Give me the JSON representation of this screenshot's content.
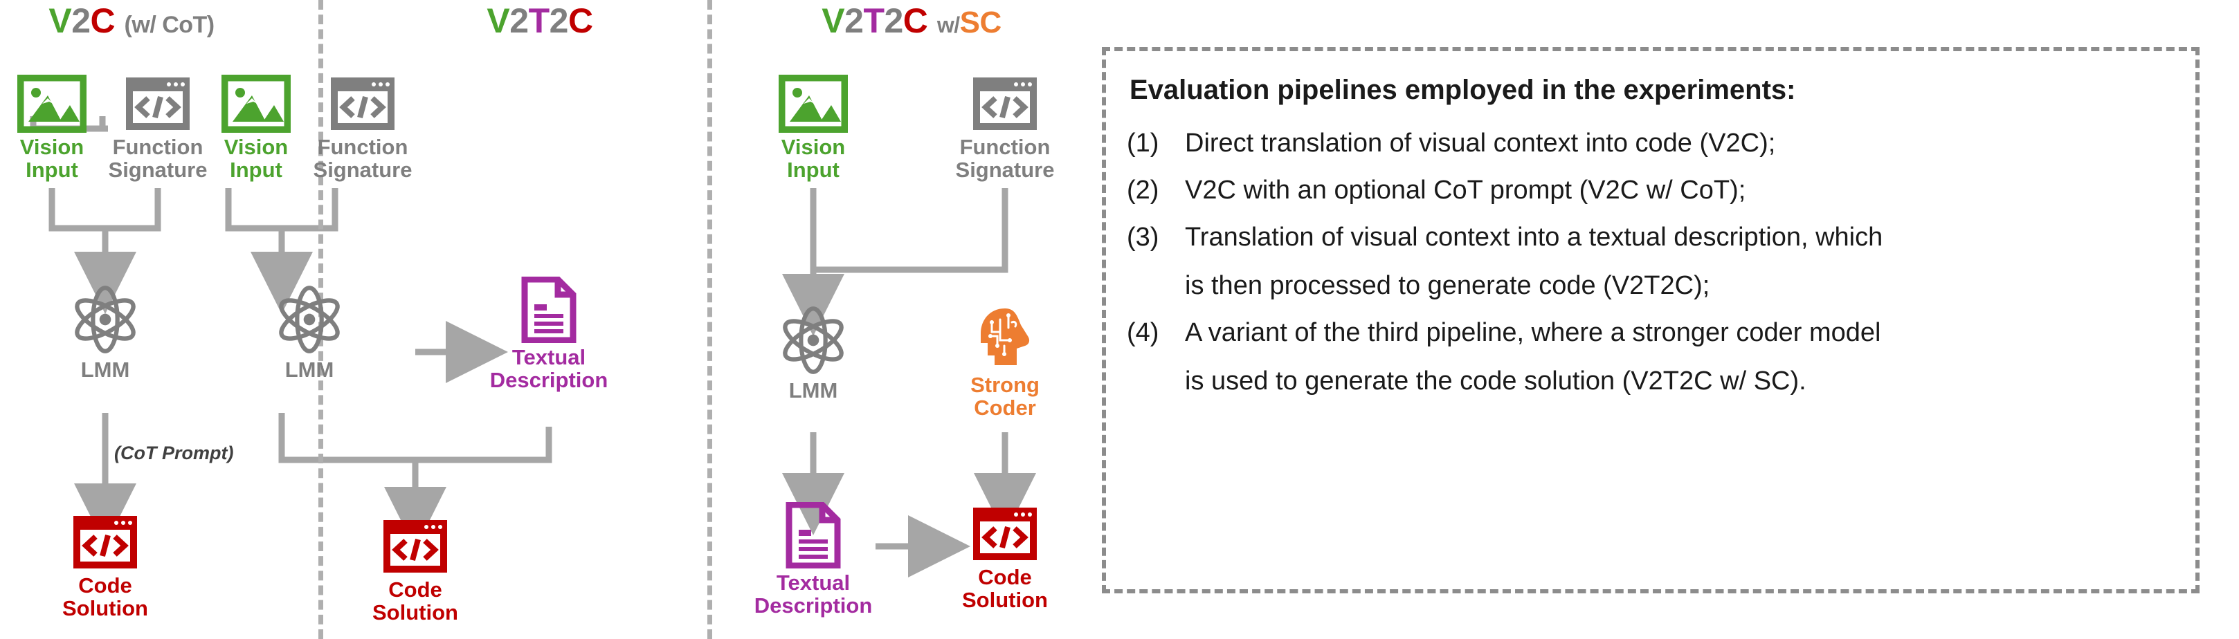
{
  "panels": [
    {
      "id": "v2c",
      "title": {
        "parts": [
          {
            "text": "V",
            "color": "#4CA32E"
          },
          {
            "text": "2",
            "color": "#7F7F7F"
          },
          {
            "text": "C",
            "color": "#C00000"
          }
        ],
        "suffix": "(w/ CoT)",
        "full": "V2C (w/ CoT)"
      },
      "nodes": {
        "vision_input": "Vision\nInput",
        "function_signature": "Function\nSignature",
        "lmm": "LMM",
        "code_solution": "Code\nSolution"
      },
      "annotation": "(CoT Prompt)"
    },
    {
      "id": "v2t2c",
      "title": {
        "parts": [
          {
            "text": "V",
            "color": "#4CA32E"
          },
          {
            "text": "2",
            "color": "#7F7F7F"
          },
          {
            "text": "T",
            "color": "#A32BA0"
          },
          {
            "text": "2",
            "color": "#7F7F7F"
          },
          {
            "text": "C",
            "color": "#C00000"
          }
        ],
        "suffix": "",
        "full": "V2T2C"
      },
      "nodes": {
        "vision_input": "Vision\nInput",
        "function_signature": "Function\nSignature",
        "lmm": "LMM",
        "textual_description": "Textual\nDescription",
        "code_solution": "Code\nSolution"
      }
    },
    {
      "id": "v2t2c-sc",
      "title": {
        "parts": [
          {
            "text": "V",
            "color": "#4CA32E"
          },
          {
            "text": "2",
            "color": "#7F7F7F"
          },
          {
            "text": "T",
            "color": "#A32BA0"
          },
          {
            "text": "2",
            "color": "#7F7F7F"
          },
          {
            "text": "C",
            "color": "#C00000"
          }
        ],
        "w_label": "w/",
        "sc_label": "SC",
        "full": "V2T2C w/ SC"
      },
      "nodes": {
        "vision_input": "Vision\nInput",
        "function_signature": "Function\nSignature",
        "lmm": "LMM",
        "strong_coder": "Strong\nCoder",
        "textual_description": "Textual\nDescription",
        "code_solution": "Code\nSolution"
      }
    }
  ],
  "infobox": {
    "heading": "Evaluation pipelines employed in the experiments:",
    "items": [
      {
        "num": "(1)",
        "line1": "Direct translation of visual context into code (V2C);",
        "line2": ""
      },
      {
        "num": "(2)",
        "line1": "V2C with an optional CoT prompt (V2C w/ CoT);",
        "line2": ""
      },
      {
        "num": "(3)",
        "line1": "Translation of visual context into a textual description, which",
        "line2": "is then processed to generate code (V2T2C);"
      },
      {
        "num": "(4)",
        "line1": "A variant of the third pipeline, where a stronger coder model",
        "line2": "is used to generate the code solution (V2T2C w/ SC)."
      }
    ]
  },
  "colors": {
    "green": "#4CA32E",
    "gray": "#7F7F7F",
    "red": "#C00000",
    "purple": "#A32BA0",
    "orange": "#ED7D31",
    "wire": "#A6A6A6",
    "dash": "#AFAFAF",
    "text_dark": "#1A1A1A"
  }
}
